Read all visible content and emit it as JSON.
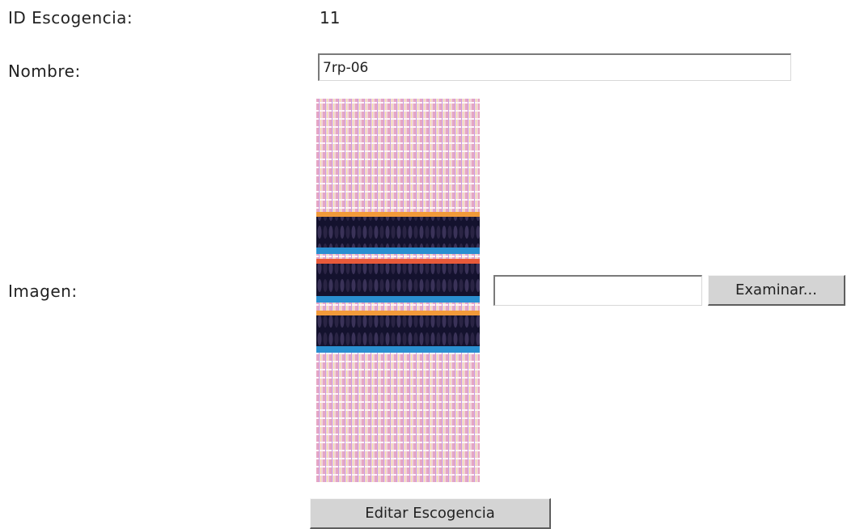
{
  "form": {
    "id_label": "ID Escogencia:",
    "id_value": "11",
    "name_label": "Nombre:",
    "name_value": "7rp-06",
    "image_label": "Imagen:",
    "file_input_value": "",
    "browse_button_label": "Examinar...",
    "submit_button_label": "Editar Escogencia"
  },
  "colors": {
    "button_face": "#d4d4d4",
    "stripe_dark": "#14122e",
    "stripe_accent": "#2a8fd0",
    "weave_base": "#e8c6d4"
  }
}
